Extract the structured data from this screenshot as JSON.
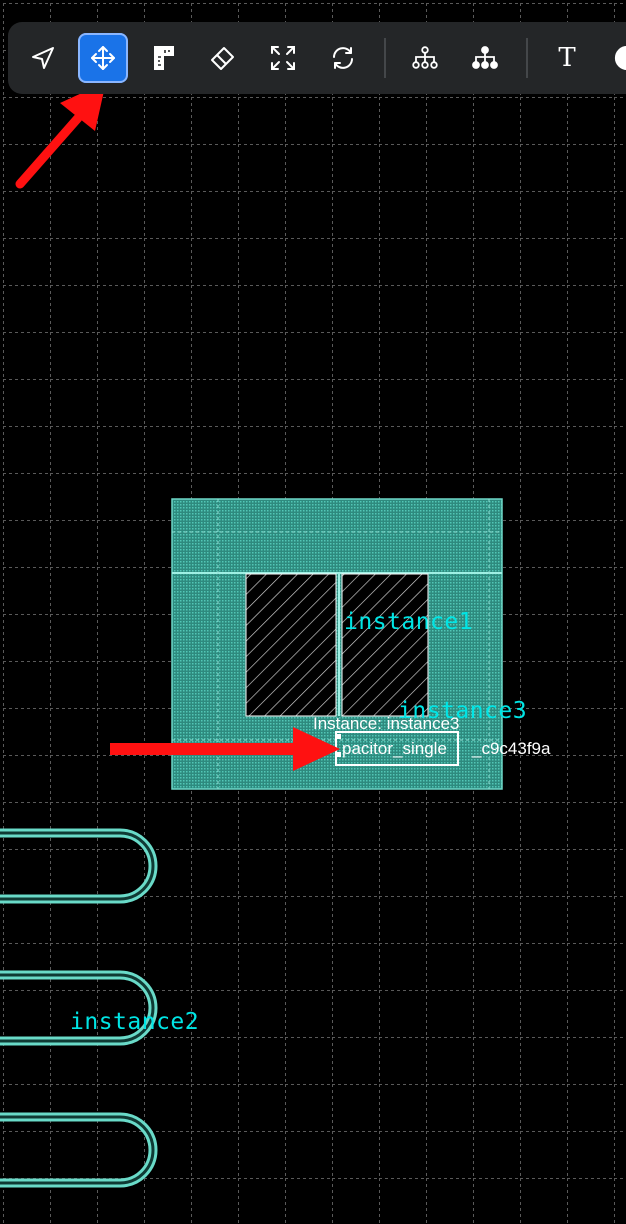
{
  "toolbar": {
    "tools": [
      {
        "name": "select",
        "icon": "navigation-arrow-icon",
        "active": false
      },
      {
        "name": "move",
        "icon": "move-arrows-icon",
        "active": true
      },
      {
        "name": "ruler",
        "icon": "ruler-icon",
        "active": false
      },
      {
        "name": "erase",
        "icon": "eraser-icon",
        "active": false
      },
      {
        "name": "fit",
        "icon": "expand-corners-icon",
        "active": false
      },
      {
        "name": "refresh",
        "icon": "refresh-icon",
        "active": false
      },
      {
        "name": "hierarchy-down",
        "icon": "hierarchy-tree-icon",
        "active": false
      },
      {
        "name": "hierarchy-up",
        "icon": "hierarchy-tree-filled-icon",
        "active": false
      },
      {
        "name": "text",
        "icon": "text-t-icon",
        "active": false
      },
      {
        "name": "theme",
        "icon": "half-circle-icon",
        "active": false
      }
    ],
    "text_tool_glyph": "T"
  },
  "canvas": {
    "instance_labels": {
      "instance1": "instance1",
      "instance2": "instance2",
      "instance3": "instance3"
    },
    "tooltip": {
      "title": "Instance: instance3",
      "cell_partial": "pacitor_single",
      "hash": "_c9c43f9a"
    }
  },
  "colors": {
    "background": "#000000",
    "toolbar": "#242628",
    "active_tool": "#1a73e8",
    "layout_teal": "#3fb8a8",
    "label_cyan": "#00e5e5",
    "annotation_red": "#ff1111"
  }
}
